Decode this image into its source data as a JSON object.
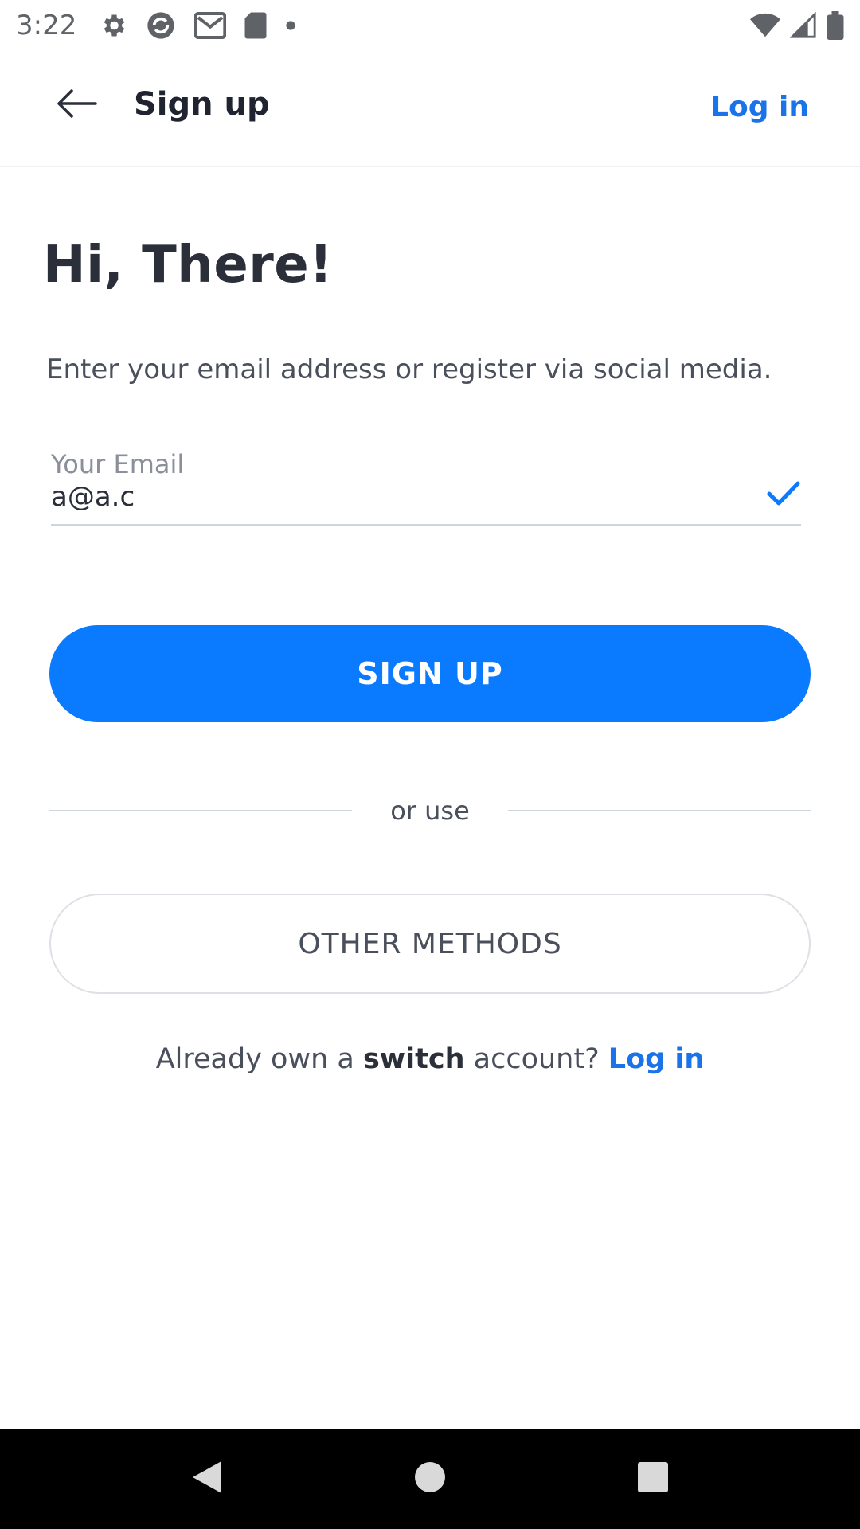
{
  "status_bar": {
    "time": "3:22",
    "icons_left": [
      "settings-icon",
      "sync-icon",
      "gmail-icon",
      "sd-card-icon",
      "dot-icon"
    ],
    "icons_right": [
      "wifi-icon",
      "signal-icon",
      "battery-icon"
    ]
  },
  "app_bar": {
    "back_icon": "arrow-left-icon",
    "title": "Sign up",
    "login_label": "Log in"
  },
  "main": {
    "heading": "Hi, There!",
    "subtitle": "Enter your email address or register via social media.",
    "email": {
      "label": "Your Email",
      "value": "a@a.c",
      "valid_icon": "check-icon"
    },
    "signup_button": "SIGN UP",
    "divider_text": "or use",
    "other_methods_button": "OTHER METHODS",
    "footer": {
      "prefix": "Already own a ",
      "brand": "switch",
      "suffix": " account? ",
      "login_link": "Log in"
    }
  },
  "nav_bar": {
    "buttons": [
      "back-triangle-icon",
      "home-circle-icon",
      "recents-square-icon"
    ]
  },
  "colors": {
    "accent": "#0a7aff",
    "link": "#1a73e8",
    "text_dark": "#2b2f3a",
    "text_muted": "#4a4f5c"
  }
}
